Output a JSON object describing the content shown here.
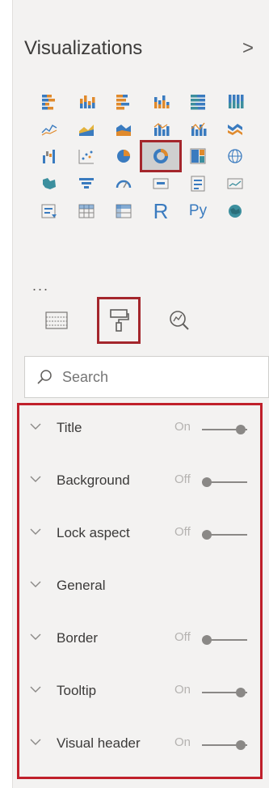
{
  "header": {
    "title": "Visualizations",
    "collapse_glyph": ">"
  },
  "viz_grid": {
    "icons": [
      "stacked-bar-chart-icon",
      "stacked-column-chart-icon",
      "clustered-bar-chart-icon",
      "clustered-column-chart-icon",
      "100-percent-stacked-bar-chart-icon",
      "100-percent-stacked-column-chart-icon",
      "line-chart-icon",
      "area-chart-icon",
      "stacked-area-chart-icon",
      "line-and-stacked-column-chart-icon",
      "line-and-clustered-column-chart-icon",
      "ribbon-chart-icon",
      "waterfall-chart-icon",
      "scatter-chart-icon",
      "pie-chart-icon",
      "donut-chart-icon",
      "treemap-icon",
      "map-icon",
      "filled-map-icon",
      "funnel-icon",
      "gauge-icon",
      "card-icon",
      "multi-row-card-icon",
      "kpi-icon",
      "slicer-icon",
      "table-icon",
      "matrix-icon",
      "r-visual-icon",
      "python-visual-icon",
      "arcgis-map-icon"
    ],
    "selected_index": 15,
    "r_label": "R",
    "py_label": "Py",
    "more_label": "..."
  },
  "pane_tabs": {
    "icons": [
      "fields-icon",
      "format-paint-roller-icon",
      "analytics-icon"
    ],
    "selected_index": 1,
    "accent_color": "#f2c811"
  },
  "search": {
    "placeholder": "Search"
  },
  "format_sections": [
    {
      "label": "Title",
      "state": "On",
      "toggle": true
    },
    {
      "label": "Background",
      "state": "Off",
      "toggle": true
    },
    {
      "label": "Lock aspect",
      "state": "Off",
      "toggle": true
    },
    {
      "label": "General",
      "state": "",
      "toggle": false
    },
    {
      "label": "Border",
      "state": "Off",
      "toggle": true
    },
    {
      "label": "Tooltip",
      "state": "On",
      "toggle": true
    },
    {
      "label": "Visual header",
      "state": "On",
      "toggle": true
    }
  ],
  "colors": {
    "highlight_border": "#c0202b",
    "panel_bg": "#f3f2f1",
    "text": "#3b3a39"
  }
}
